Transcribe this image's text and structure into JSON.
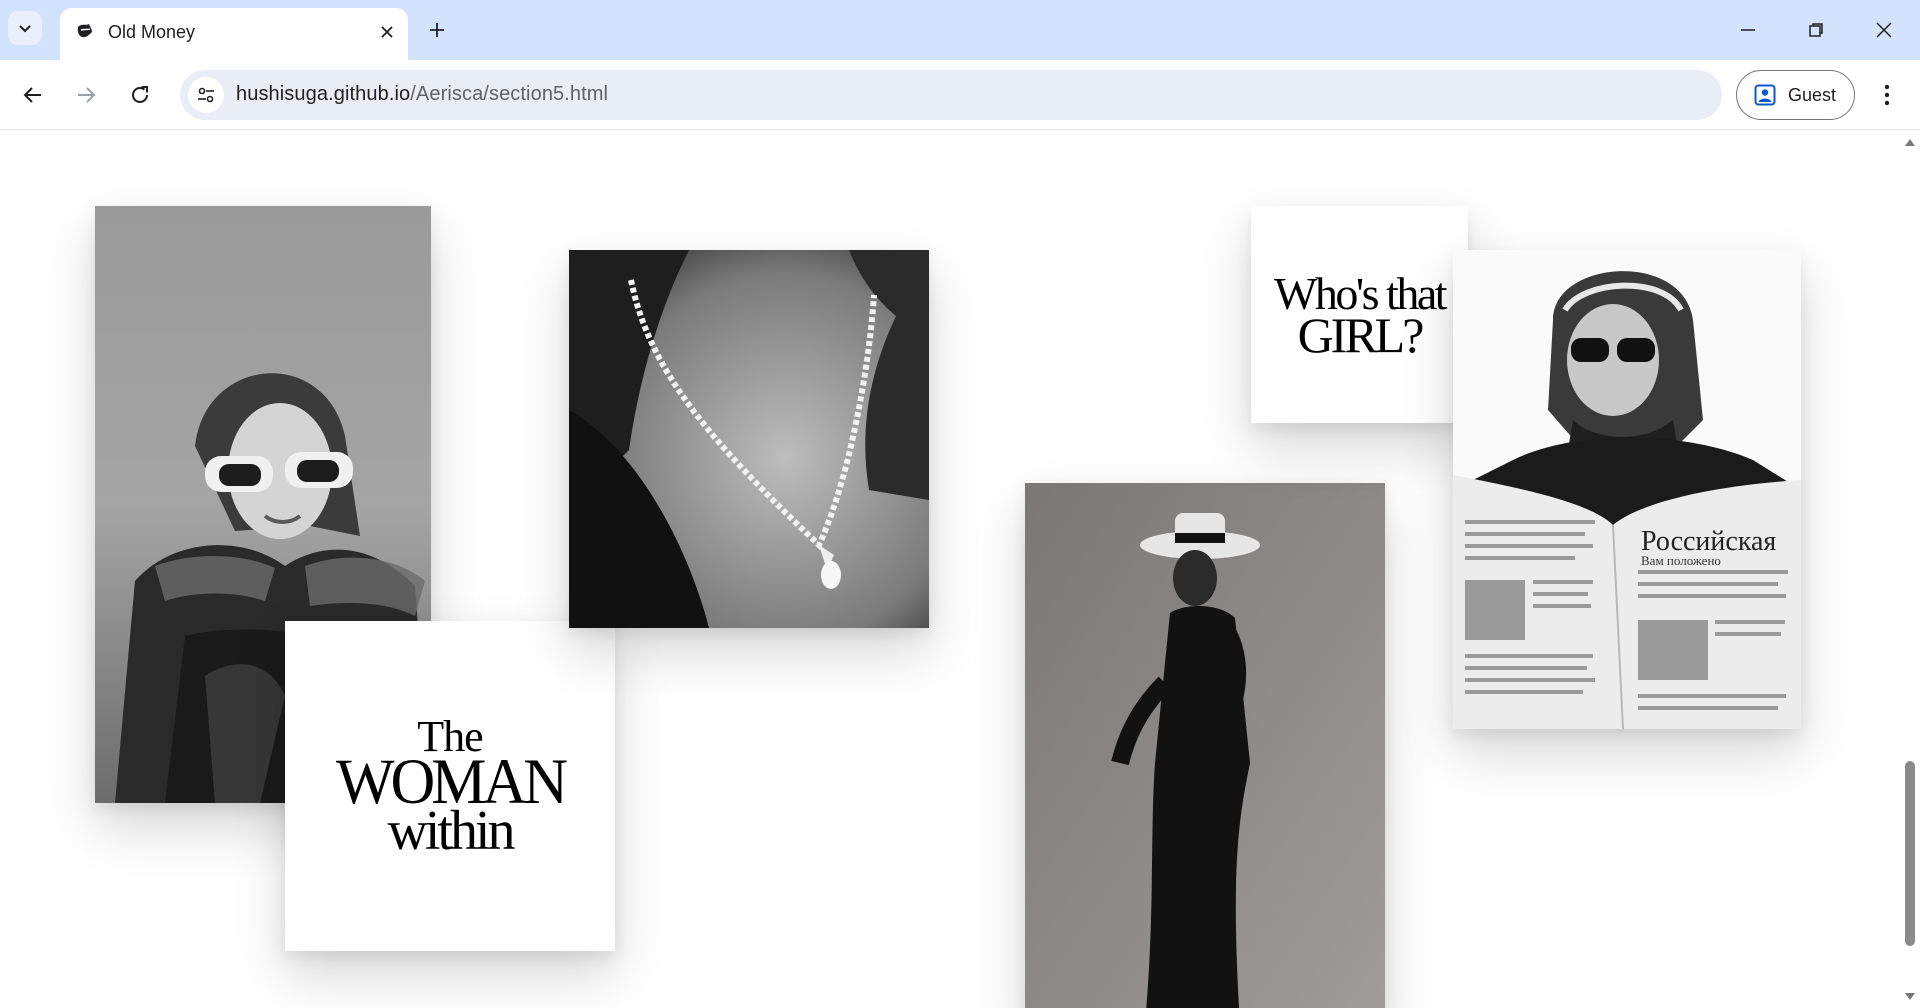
{
  "browser": {
    "tab": {
      "title": "Old Money"
    },
    "address": {
      "host": "hushisuga.github.io",
      "path": "/Aerisca/section5.html"
    },
    "profile": {
      "label": "Guest"
    },
    "icons": {
      "tab_search": "chevron-down-icon",
      "favicon": "lips-icon",
      "close": "close-icon",
      "new_tab": "plus-icon",
      "minimize": "minimize-icon",
      "restore": "restore-icon",
      "window_close": "close-icon",
      "back": "arrow-left-icon",
      "forward": "arrow-right-icon",
      "reload": "reload-icon",
      "site_info": "tune-icon",
      "profile": "person-icon",
      "menu": "kebab-icon"
    }
  },
  "page": {
    "cards": {
      "woman_within": {
        "line1": "The",
        "line2": "WOMAN",
        "line3": "within"
      },
      "whos_that_girl": {
        "line1": "Who's that",
        "line2": "GIRL?"
      }
    },
    "newspaper_text": {
      "masthead": "Российская",
      "subhead": "Вам положено"
    },
    "photos": [
      "woman-headscarf-sunglasses-photo",
      "diamond-necklace-photo",
      "woman-hat-black-dress-photo",
      "woman-reading-newspaper-photo"
    ],
    "colors": {
      "background": "#ffffff",
      "tabbar": "#d3e3fd",
      "omnibox": "#e9eef6"
    }
  }
}
